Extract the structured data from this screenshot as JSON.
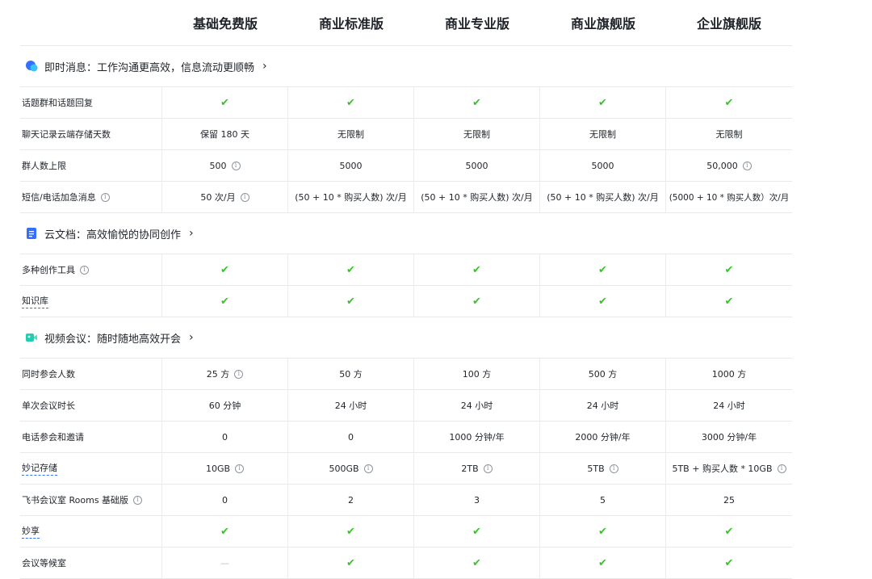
{
  "plans": [
    "基础免费版",
    "商业标准版",
    "商业专业版",
    "商业旗舰版",
    "企业旗舰版"
  ],
  "colors": {
    "check": "#34c724",
    "im_icon": "#3370ff",
    "docs_icon": "#3370ff",
    "video_icon": "#1fcfb0"
  },
  "sections": [
    {
      "title": "即时消息：工作沟通更高效，信息流动更顺畅",
      "icon": "chat-bubble-icon",
      "rows": [
        {
          "feature": "话题群和话题回复",
          "cells": [
            "✔",
            "✔",
            "✔",
            "✔",
            "✔"
          ]
        },
        {
          "feature": "聊天记录云端存储天数",
          "cells": [
            "保留 180 天",
            "无限制",
            "无限制",
            "无限制",
            "无限制"
          ]
        },
        {
          "feature": "群人数上限",
          "cells": [
            "500",
            "5000",
            "5000",
            "5000",
            "50,000"
          ]
        },
        {
          "feature": "短信/电话加急消息",
          "cells": [
            "50 次/月",
            "(50 + 10 * 购买人数) 次/月",
            "(50 + 10 * 购买人数) 次/月",
            "(50 + 10 * 购买人数) 次/月",
            "(5000 + 10 * 购买人数）次/月"
          ]
        }
      ]
    },
    {
      "title": "云文档：高效愉悦的协同创作",
      "icon": "document-icon",
      "rows": [
        {
          "feature": "多种创作工具",
          "cells": [
            "✔",
            "✔",
            "✔",
            "✔",
            "✔"
          ]
        },
        {
          "feature": "知识库",
          "cells": [
            "✔",
            "✔",
            "✔",
            "✔",
            "✔"
          ]
        }
      ]
    },
    {
      "title": "视频会议：随时随地高效开会",
      "icon": "video-camera-icon",
      "rows": [
        {
          "feature": "同时参会人数",
          "cells": [
            "25 方",
            "50 方",
            "100 方",
            "500 方",
            "1000 方"
          ]
        },
        {
          "feature": "单次会议时长",
          "cells": [
            "60 分钟",
            "24 小时",
            "24 小时",
            "24 小时",
            "24 小时"
          ]
        },
        {
          "feature": "电话参会和邀请",
          "cells": [
            "0",
            "0",
            "1000 分钟/年",
            "2000 分钟/年",
            "3000 分钟/年"
          ]
        },
        {
          "feature": "妙记存储",
          "cells": [
            "10GB",
            "500GB",
            "2TB",
            "5TB",
            "5TB + 购买人数 * 10GB"
          ]
        },
        {
          "feature": "飞书会议室 Rooms 基础版",
          "cells": [
            "0",
            "2",
            "3",
            "5",
            "25"
          ]
        },
        {
          "feature": "妙享",
          "cells": [
            "✔",
            "✔",
            "✔",
            "✔",
            "✔"
          ]
        },
        {
          "feature": "会议等候室",
          "cells": [
            "—",
            "✔",
            "✔",
            "✔",
            "✔"
          ]
        }
      ]
    }
  ]
}
